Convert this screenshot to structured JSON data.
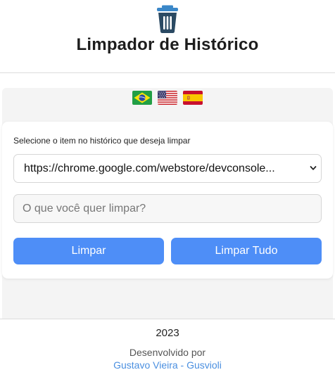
{
  "header": {
    "icon": "trash-can-icon",
    "title": "Limpador de Histórico"
  },
  "languages": [
    {
      "code": "pt-BR",
      "icon": "brazil-flag-icon"
    },
    {
      "code": "en-US",
      "icon": "usa-flag-icon"
    },
    {
      "code": "es",
      "icon": "spain-flag-icon"
    }
  ],
  "form": {
    "label": "Selecione o item no histórico que deseja limpar",
    "selected_item": "https://chrome.google.com/webstore/devconsole...",
    "search_placeholder": "O que você quer limpar?",
    "search_value": "",
    "clear_button": "Limpar",
    "clear_all_button": "Limpar Tudo"
  },
  "footer": {
    "year": "2023",
    "developed_by": "Desenvolvido por",
    "author_link": "Gustavo Vieira - Gusvioli"
  },
  "colors": {
    "accent": "#4e8ef7",
    "link": "#4a8fe0",
    "icon": "#2b4a63"
  }
}
